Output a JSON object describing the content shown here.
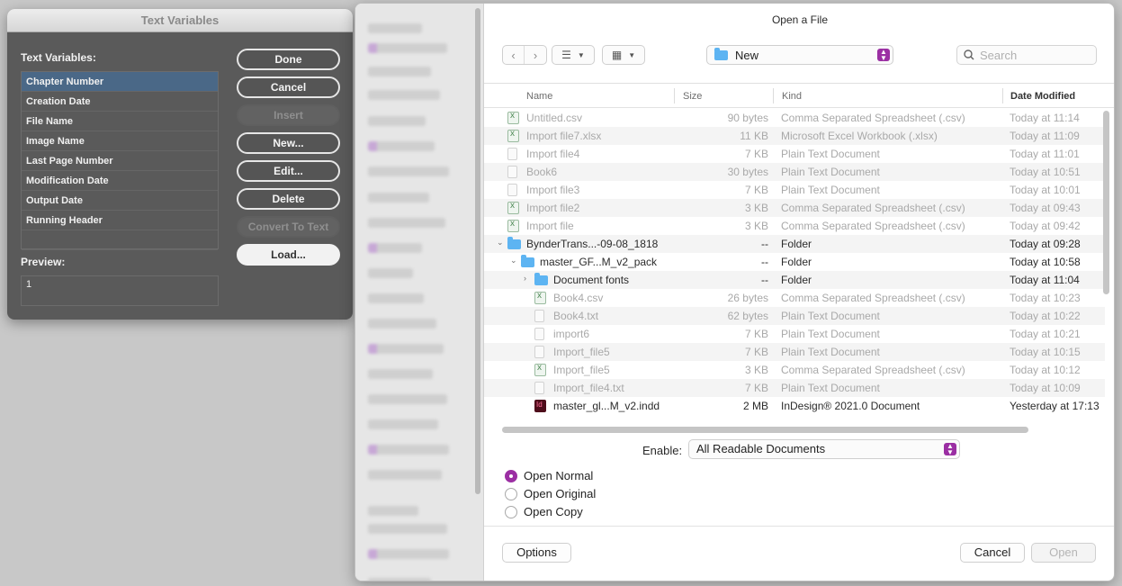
{
  "text_variables": {
    "title": "Text Variables",
    "heading": "Text Variables:",
    "items": [
      {
        "label": "Chapter Number",
        "selected": true
      },
      {
        "label": "Creation Date"
      },
      {
        "label": "File Name"
      },
      {
        "label": "Image Name"
      },
      {
        "label": "Last Page Number"
      },
      {
        "label": "Modification Date"
      },
      {
        "label": "Output Date"
      },
      {
        "label": "Running Header"
      }
    ],
    "preview_label": "Preview:",
    "preview_value": "1",
    "buttons": {
      "done": "Done",
      "cancel": "Cancel",
      "insert": "Insert",
      "new": "New...",
      "edit": "Edit...",
      "delete": "Delete",
      "convert": "Convert To Text",
      "load": "Load..."
    }
  },
  "open_dialog": {
    "title": "Open a File",
    "location": "New",
    "search_placeholder": "Search",
    "columns": {
      "name": "Name",
      "size": "Size",
      "kind": "Kind",
      "date": "Date Modified"
    },
    "files": [
      {
        "name": "Untitled.csv",
        "size": "90 bytes",
        "kind": "Comma Separated Spreadsheet (.csv)",
        "date": "Today at 11:14",
        "icon": "csv",
        "indent": 0
      },
      {
        "name": "Import file7.xlsx",
        "size": "11 KB",
        "kind": "Microsoft Excel Workbook (.xlsx)",
        "date": "Today at 11:09",
        "icon": "csv",
        "indent": 0
      },
      {
        "name": "Import file4",
        "size": "7 KB",
        "kind": "Plain Text Document",
        "date": "Today at 11:01",
        "icon": "txt",
        "indent": 0
      },
      {
        "name": "Book6",
        "size": "30 bytes",
        "kind": "Plain Text Document",
        "date": "Today at 10:51",
        "icon": "txt",
        "indent": 0
      },
      {
        "name": "Import file3",
        "size": "7 KB",
        "kind": "Plain Text Document",
        "date": "Today at 10:01",
        "icon": "txt",
        "indent": 0
      },
      {
        "name": "Import file2",
        "size": "3 KB",
        "kind": "Comma Separated Spreadsheet (.csv)",
        "date": "Today at 09:43",
        "icon": "csv",
        "indent": 0
      },
      {
        "name": "Import file",
        "size": "3 KB",
        "kind": "Comma Separated Spreadsheet (.csv)",
        "date": "Today at 09:42",
        "icon": "csv",
        "indent": 0
      },
      {
        "name": "BynderTrans...-09-08_1818",
        "size": "--",
        "kind": "Folder",
        "date": "Today at 09:28",
        "icon": "folder",
        "indent": 0,
        "active": true,
        "disclosure": "open"
      },
      {
        "name": "master_GF...M_v2_pack",
        "size": "--",
        "kind": "Folder",
        "date": "Today at 10:58",
        "icon": "folder",
        "indent": 1,
        "active": true,
        "disclosure": "open"
      },
      {
        "name": "Document fonts",
        "size": "--",
        "kind": "Folder",
        "date": "Today at 11:04",
        "icon": "folder",
        "indent": 2,
        "active": true,
        "disclosure": "closed"
      },
      {
        "name": "Book4.csv",
        "size": "26 bytes",
        "kind": "Comma Separated Spreadsheet (.csv)",
        "date": "Today at 10:23",
        "icon": "csv",
        "indent": 2
      },
      {
        "name": "Book4.txt",
        "size": "62 bytes",
        "kind": "Plain Text Document",
        "date": "Today at 10:22",
        "icon": "txt",
        "indent": 2
      },
      {
        "name": "import6",
        "size": "7 KB",
        "kind": "Plain Text Document",
        "date": "Today at 10:21",
        "icon": "txt",
        "indent": 2
      },
      {
        "name": "Import_file5",
        "size": "7 KB",
        "kind": "Plain Text Document",
        "date": "Today at 10:15",
        "icon": "txt",
        "indent": 2
      },
      {
        "name": "Import_file5",
        "size": "3 KB",
        "kind": "Comma Separated Spreadsheet (.csv)",
        "date": "Today at 10:12",
        "icon": "csv",
        "indent": 2
      },
      {
        "name": "Import_file4.txt",
        "size": "7 KB",
        "kind": "Plain Text Document",
        "date": "Today at 10:09",
        "icon": "txt",
        "indent": 2
      },
      {
        "name": "master_gl...M_v2.indd",
        "size": "2 MB",
        "kind": "InDesign® 2021.0 Document",
        "date": "Yesterday at 17:13",
        "icon": "indd",
        "indent": 2,
        "active": true
      }
    ],
    "enable_label": "Enable:",
    "enable_value": "All Readable Documents",
    "open_options": [
      {
        "label": "Open Normal",
        "checked": true
      },
      {
        "label": "Open Original"
      },
      {
        "label": "Open Copy"
      }
    ],
    "buttons": {
      "options": "Options",
      "cancel": "Cancel",
      "open": "Open"
    }
  },
  "colors": {
    "accent": "#9b2fa3",
    "selection": "#4a6887",
    "folder": "#5db4f2"
  }
}
